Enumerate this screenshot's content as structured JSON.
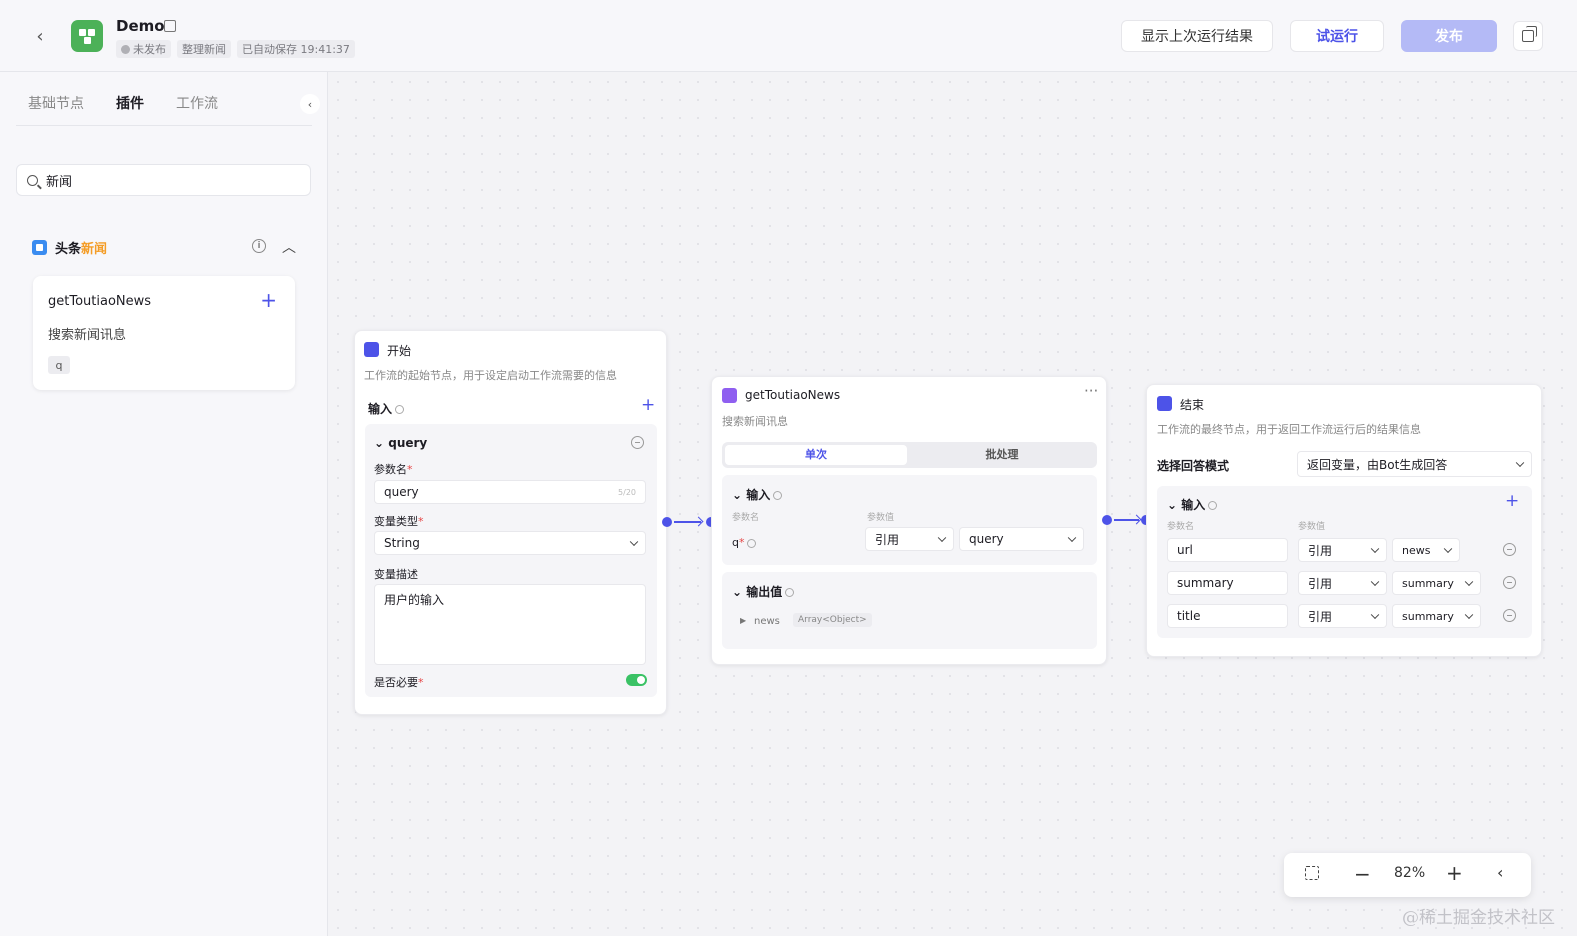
{
  "header": {
    "title": "Demo",
    "status": "未发布",
    "tag": "整理新闻",
    "autosave": "已自动保存 19:41:37",
    "btn_result": "显示上次运行结果",
    "btn_test": "试运行",
    "btn_publish": "发布"
  },
  "sidebar": {
    "tabs": [
      "基础节点",
      "插件",
      "工作流"
    ],
    "search_value": "新闻",
    "group_name_a": "头条",
    "group_name_b": "新闻",
    "plugin": {
      "name": "getToutiaoNews",
      "desc": "搜索新闻讯息",
      "param": "q"
    }
  },
  "start_node": {
    "title": "开始",
    "desc": "工作流的起始节点，用于设定启动工作流需要的信息",
    "input_label": "输入",
    "param_group": "query",
    "param_name_label": "参数名",
    "param_name_value": "query",
    "param_name_count": "5/20",
    "var_type_label": "变量类型",
    "var_type_value": "String",
    "var_desc_label": "变量描述",
    "var_desc_value": "用户的输入",
    "required_label": "是否必要"
  },
  "plugin_node": {
    "title": "getToutiaoNews",
    "desc": "搜索新闻讯息",
    "tab_single": "单次",
    "tab_batch": "批处理",
    "input_label": "输入",
    "col_name": "参数名",
    "col_value": "参数值",
    "param": "q",
    "ref_label": "引用",
    "ref_value": "query",
    "output_label": "输出值",
    "output_name": "news",
    "output_type": "Array<Object>"
  },
  "end_node": {
    "title": "结束",
    "desc": "工作流的最终节点，用于返回工作流运行后的结果信息",
    "mode_label": "选择回答模式",
    "mode_value": "返回变量，由Bot生成回答",
    "input_label": "输入",
    "col_name": "参数名",
    "col_value": "参数值",
    "rows": [
      {
        "name": "url",
        "ref": "引用",
        "value": "news"
      },
      {
        "name": "summary",
        "ref": "引用",
        "value": "summary"
      },
      {
        "name": "title",
        "ref": "引用",
        "value": "summary"
      }
    ]
  },
  "zoom": {
    "level": "82%"
  },
  "watermark": "@稀土掘金技术社区",
  "colors": {
    "accent": "#4d53e8",
    "toggle_on": "#3ac265",
    "highlight": "#f49d27"
  }
}
